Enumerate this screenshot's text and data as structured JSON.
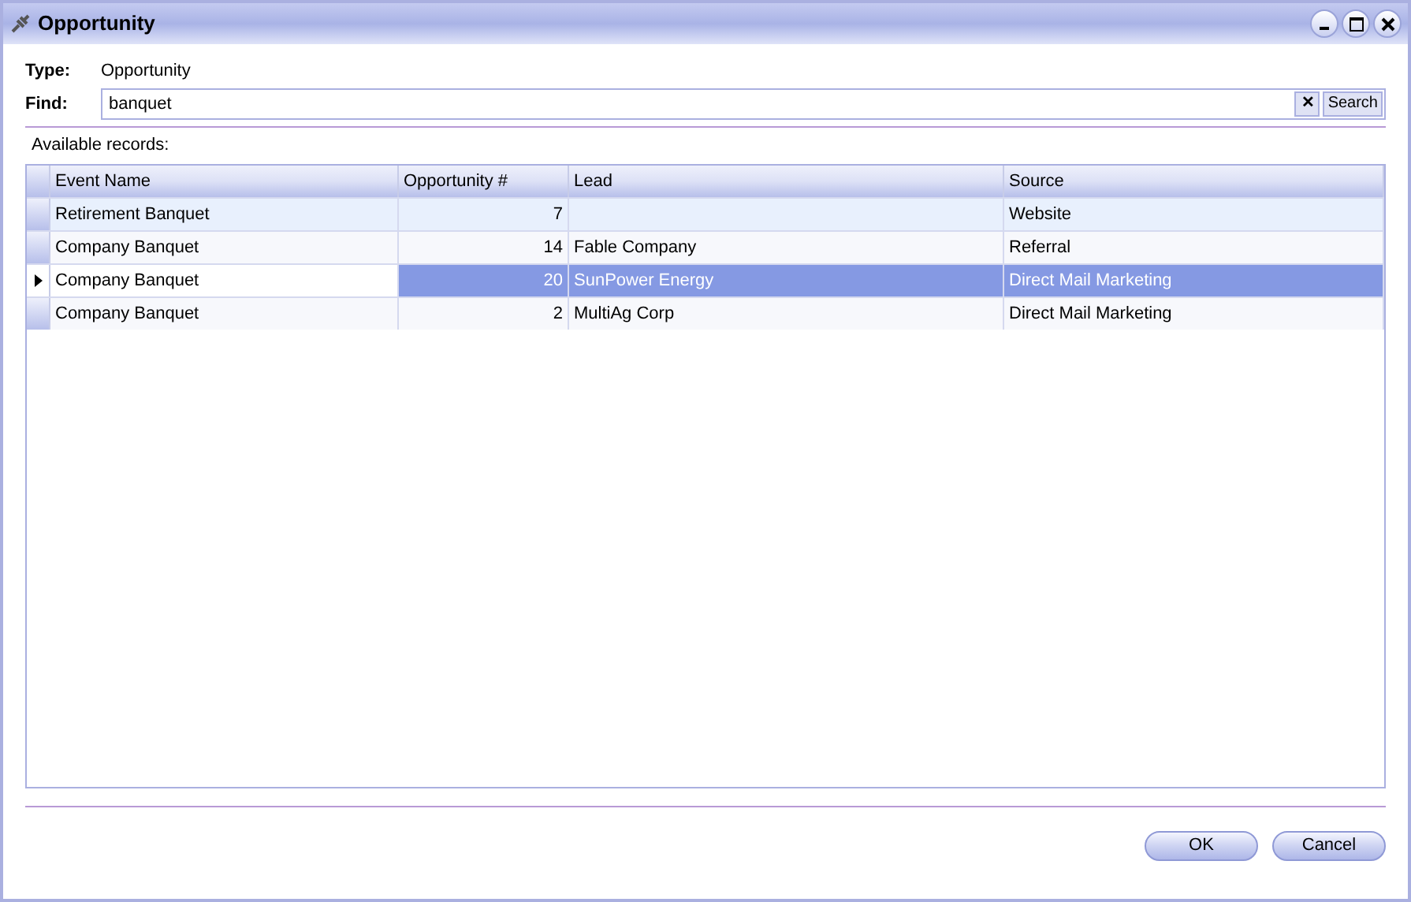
{
  "window": {
    "title": "Opportunity"
  },
  "type": {
    "label": "Type:",
    "value": "Opportunity"
  },
  "find": {
    "label": "Find:",
    "value": "banquet",
    "clear": "✕",
    "search": "Search"
  },
  "records_label": "Available records:",
  "table": {
    "columns": [
      "Event Name",
      "Opportunity #",
      "Lead",
      "Source"
    ],
    "rows": [
      {
        "cells": [
          "Retirement Banquet",
          "7",
          "",
          "Website"
        ],
        "selected": false,
        "current": false,
        "highlighted": true
      },
      {
        "cells": [
          "Company Banquet",
          "14",
          "Fable Company",
          "Referral"
        ],
        "selected": false,
        "current": false,
        "highlighted": false
      },
      {
        "cells": [
          "Company Banquet",
          "20",
          "SunPower Energy",
          "Direct Mail Marketing"
        ],
        "selected": true,
        "current": true,
        "highlighted": false
      },
      {
        "cells": [
          "Company Banquet",
          "2",
          "MultiAg Corp",
          "Direct Mail Marketing"
        ],
        "selected": false,
        "current": false,
        "highlighted": false
      }
    ]
  },
  "buttons": [
    "OK",
    "Cancel"
  ]
}
